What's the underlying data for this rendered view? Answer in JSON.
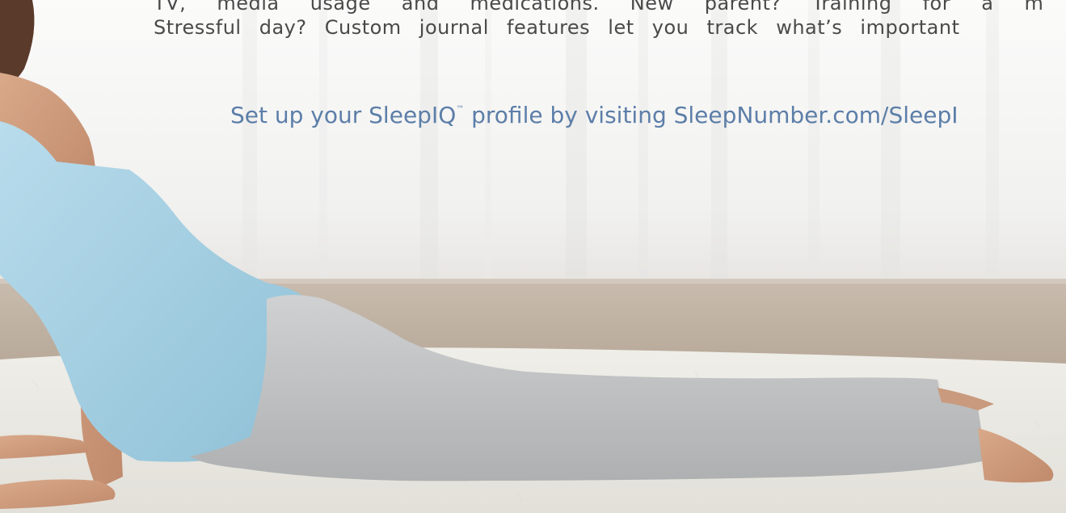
{
  "body_text": {
    "line_1": "TV, media usage and medications. New parent? Training for a m",
    "line_2": "Stressful day? Custom journal features let you track what’s important"
  },
  "cta": {
    "before_tm": "Set up your SleepIQ",
    "tm": "™",
    "after_tm": " profile by visiting SleepNumber.com/SleepI"
  },
  "colors": {
    "body_text": "#4a4a4a",
    "cta_text": "#5c7ea8",
    "tank_top": "#a9d1e3",
    "pants": "#c4c6c7",
    "rug": "#ecebe5"
  }
}
